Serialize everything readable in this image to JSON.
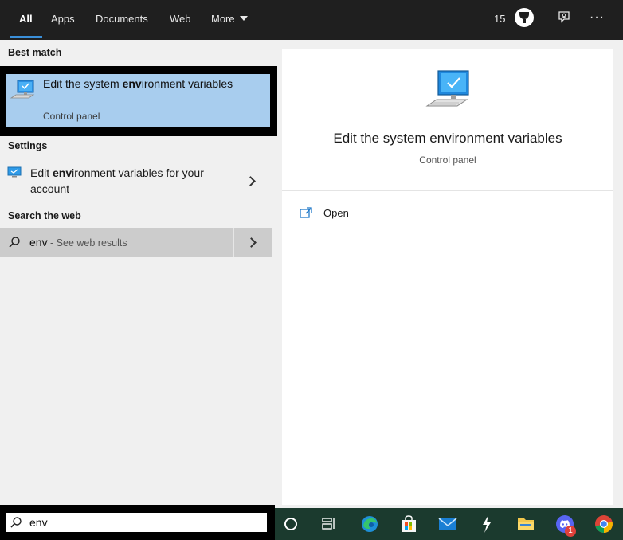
{
  "tabs": [
    {
      "label": "All",
      "active": true
    },
    {
      "label": "Apps",
      "active": false
    },
    {
      "label": "Documents",
      "active": false
    },
    {
      "label": "Web",
      "active": false
    },
    {
      "label": "More",
      "active": false
    }
  ],
  "header": {
    "points": "15",
    "icons": [
      "trophy-icon",
      "feedback-icon",
      "more-options-icon"
    ],
    "more_options_label": "···"
  },
  "sections": {
    "best_match": "Best match",
    "settings": "Settings",
    "search_the_web": "Search the web"
  },
  "best_match": {
    "title_before": "Edit the system ",
    "title_bold": "env",
    "title_after": "ironment variables",
    "subtitle": "Control panel",
    "icon": "computer-monitor-icon"
  },
  "settings_item": {
    "title_before": "Edit ",
    "title_bold": "env",
    "title_after": "ironment variables for your account",
    "icon": "settings-monitor-icon"
  },
  "web_result": {
    "query": "env",
    "hint": " - See web results"
  },
  "detail": {
    "title": "Edit the system environment variables",
    "subtitle": "Control panel",
    "actions": [
      {
        "label": "Open",
        "icon": "open-window-icon"
      }
    ]
  },
  "search": {
    "value": "env",
    "placeholder": ""
  },
  "taskbar": {
    "apps": [
      "cortana-icon",
      "task-view-icon",
      "edge-icon",
      "store-icon",
      "mail-icon",
      "bolt-app-icon",
      "file-explorer-icon",
      "discord-icon",
      "chrome-icon"
    ],
    "discord_badge": "1"
  },
  "colors": {
    "accent": "#3a8fd9",
    "selected": "#a8cdee",
    "header_bg": "#1f1f1f",
    "panel_bg": "#f0f0f0",
    "web_row_bg": "#cccccc"
  }
}
